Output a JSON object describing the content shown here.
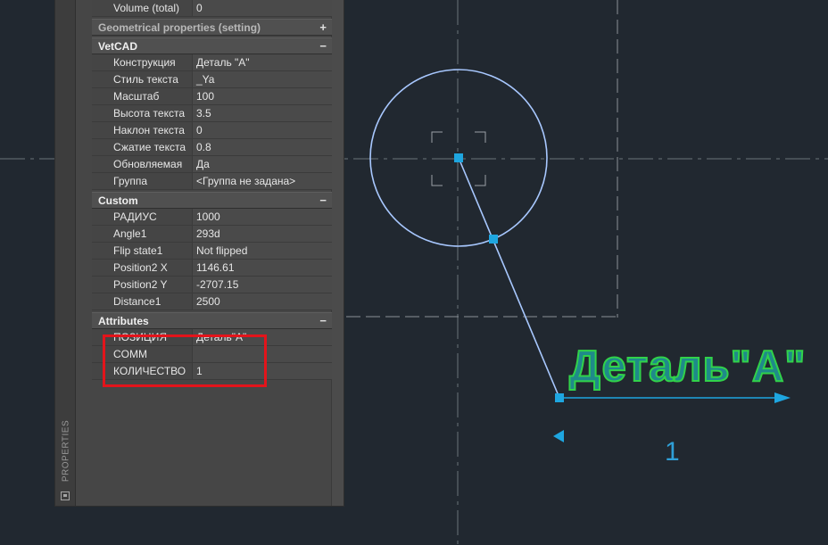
{
  "properties_palette": {
    "title": "PROPERTIES",
    "rows_top": [
      {
        "key": "Volume (total)",
        "value": "0"
      }
    ],
    "sections": [
      {
        "title": "Geometrical properties (setting)",
        "toggle": "+",
        "expanded": false,
        "rows": []
      },
      {
        "title": "VetCAD",
        "toggle": "−",
        "expanded": true,
        "rows": [
          {
            "key": "Конструкция",
            "value": "Деталь \"А\""
          },
          {
            "key": "Стиль текста",
            "value": "_Ya"
          },
          {
            "key": "Масштаб",
            "value": "100"
          },
          {
            "key": "Высота текста",
            "value": "3.5"
          },
          {
            "key": "Наклон текста",
            "value": "0"
          },
          {
            "key": "Сжатие текста",
            "value": "0.8"
          },
          {
            "key": "Обновляемая",
            "value": "Да"
          },
          {
            "key": "Группа",
            "value": "<Группа не задана>"
          }
        ]
      },
      {
        "title": "Custom",
        "toggle": "−",
        "expanded": true,
        "rows": [
          {
            "key": "РАДИУС",
            "value": "1000"
          },
          {
            "key": "Angle1",
            "value": "293d"
          },
          {
            "key": "Flip state1",
            "value": "Not flipped"
          },
          {
            "key": "Position2 X",
            "value": "1146.61"
          },
          {
            "key": "Position2 Y",
            "value": "-2707.15"
          },
          {
            "key": "Distance1",
            "value": "2500"
          }
        ]
      },
      {
        "title": "Attributes",
        "toggle": "−",
        "expanded": true,
        "rows": [
          {
            "key": "ПОЗИЦИЯ",
            "value": "Деталь\"А\""
          },
          {
            "key": "COMM",
            "value": ""
          },
          {
            "key": "КОЛИЧЕСТВО",
            "value": "1"
          }
        ]
      }
    ]
  },
  "drawing": {
    "label_text": "Деталь\"А\"",
    "position_number": "1"
  },
  "colors": {
    "background": "#212830",
    "palette_bg": "#464646",
    "highlight": "#e3141b",
    "selection": "#1ea6e0",
    "circle": "#a8c8ff",
    "text_fill": "#1f8a8a",
    "text_outline": "#31d24a",
    "number": "#2fa0d8"
  },
  "icons": [
    "palette-settings-icon",
    "arrow-right-icon",
    "arrow-left-icon"
  ]
}
